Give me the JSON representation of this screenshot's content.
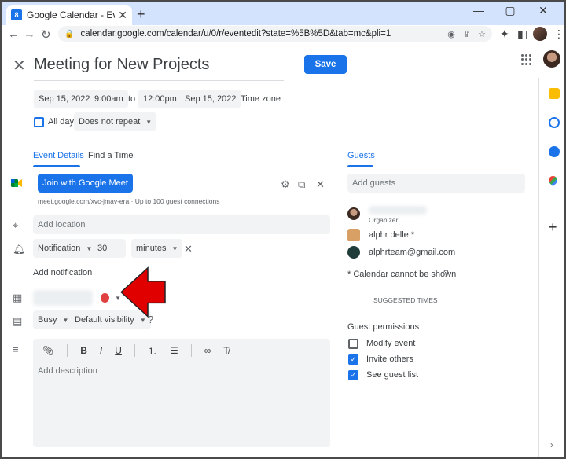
{
  "browser": {
    "tab_title": "Google Calendar - Event details",
    "tab_close": "✕",
    "new_tab": "+",
    "url": "calendar.google.com/calendar/u/0/r/eventedit?state=%5B%5D&tab=mc&pli=1",
    "favicon_text": "8"
  },
  "event": {
    "title": "Meeting for New Projects",
    "save_label": "Save",
    "start_date": "Sep 15, 2022",
    "start_time": "9:00am",
    "to_label": "to",
    "end_time": "12:00pm",
    "end_date": "Sep 15, 2022",
    "timezone_label": "Time zone",
    "all_day_label": "All day",
    "repeat_value": "Does not repeat"
  },
  "tabs": {
    "event_details": "Event Details",
    "find_time": "Find a Time"
  },
  "meet": {
    "button_label": "Join with Google Meet",
    "link_text": "meet.google.com/xvc-jmav-era · Up to 100 guest connections"
  },
  "location": {
    "placeholder": "Add location"
  },
  "notification": {
    "type": "Notification",
    "amount": "30",
    "unit": "minutes",
    "add_label": "Add notification"
  },
  "status": {
    "busy": "Busy",
    "visibility": "Default visibility",
    "event_color": "#d50000"
  },
  "description": {
    "placeholder": "Add description"
  },
  "guests": {
    "title": "Guests",
    "add_placeholder": "Add guests",
    "organizer_label": "Organizer",
    "list": [
      {
        "name": "alphr delle *"
      },
      {
        "name": "alphrteam@gmail.com"
      }
    ],
    "calendar_notice": "* Calendar cannot be shown",
    "suggested_times": "SUGGESTED TIMES",
    "permissions_title": "Guest permissions",
    "permissions": [
      {
        "label": "Modify event",
        "checked": false
      },
      {
        "label": "Invite others",
        "checked": true
      },
      {
        "label": "See guest list",
        "checked": true
      }
    ]
  },
  "colors": {
    "accent": "#1a73e8",
    "arrow": "#e00000"
  }
}
